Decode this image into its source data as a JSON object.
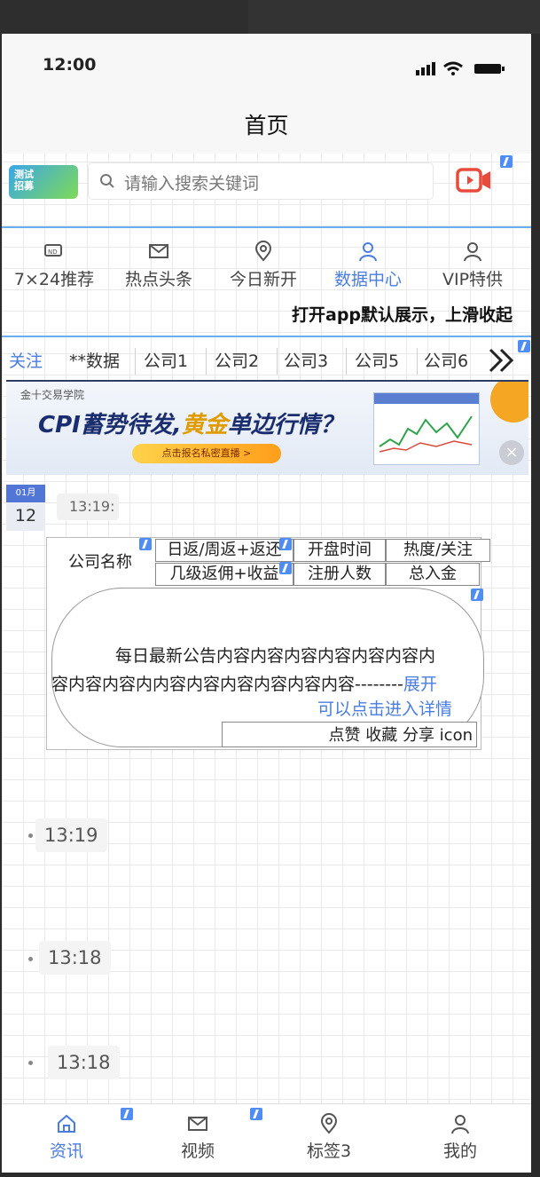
{
  "status_bar": {
    "time": "12:00"
  },
  "header": {
    "title": "首页"
  },
  "search": {
    "placeholder": "请输入搜索关键词",
    "logo_text": "测试招募"
  },
  "nav": [
    {
      "label": "7×24推荐",
      "icon": "news-icon"
    },
    {
      "label": "热点头条",
      "icon": "mail-icon"
    },
    {
      "label": "今日新开",
      "icon": "location-icon"
    },
    {
      "label": "数据中心",
      "icon": "user-icon",
      "active": true
    },
    {
      "label": "VIP特供",
      "icon": "user-icon"
    }
  ],
  "marquee": "打开app默认展示，上滑收起",
  "tabs": [
    "关注",
    "**数据",
    "公司1",
    "公司2",
    "公司3",
    "公司5",
    "公司6"
  ],
  "banner": {
    "org": "金十交易学院",
    "headline_a": "CPI蓄势待发,",
    "headline_b": "黄金",
    "headline_c": "单边行情？",
    "cta": "点击报名私密直播 >"
  },
  "feed": {
    "date_month": "01月",
    "date_day": "12",
    "first_time": "13:19:",
    "card": {
      "company_name": "公司名称",
      "col_returns": "日返/周返+返还",
      "col_open_time": "开盘时间",
      "col_heat": "热度/关注",
      "col_levels": "几级返佣+收益",
      "col_registered": "注册人数",
      "col_deposit": "总入金",
      "notice_line1": "每日最新公告内容内容内容内容内容内容内",
      "notice_line2": "容内容内容内内容内容内容内容内容内容--------",
      "expand": "展开",
      "detail_hint": "可以点击进入详情",
      "actions": "点赞  收藏  分享 icon"
    },
    "timeline": [
      "13:19",
      "13:18",
      "13:18"
    ]
  },
  "bottom_nav": [
    {
      "label": "资讯",
      "icon": "home-icon",
      "active": true
    },
    {
      "label": "视频",
      "icon": "mail-icon"
    },
    {
      "label": "标签3",
      "icon": "location-icon"
    },
    {
      "label": "我的",
      "icon": "user-icon"
    }
  ],
  "colors": {
    "accent": "#4a7de0",
    "video": "#e84b3c",
    "divider": "#6aaef2"
  }
}
